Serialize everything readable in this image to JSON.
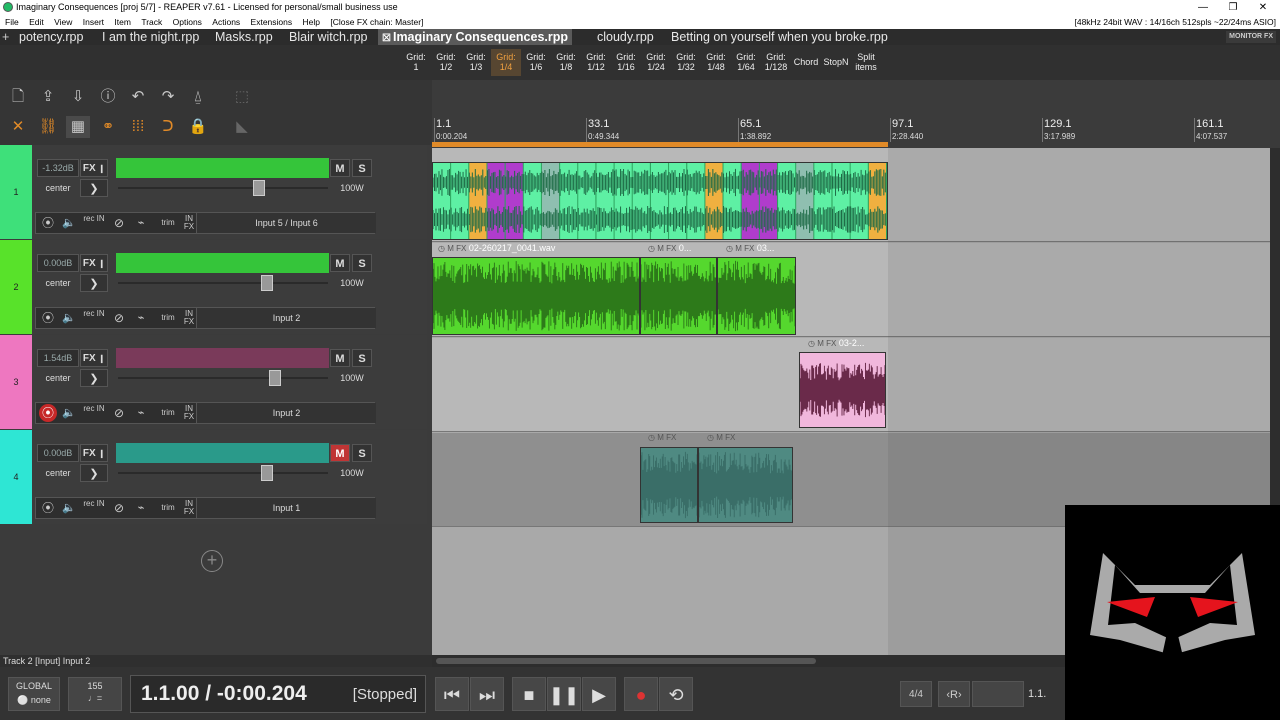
{
  "window": {
    "title": "Imaginary Consequences [proj 5/7] - REAPER v7.61 - Licensed for personal/small business use",
    "minimize": "—",
    "maximize": "❐",
    "close": "✕"
  },
  "menu": {
    "items": [
      "File",
      "Edit",
      "View",
      "Insert",
      "Item",
      "Track",
      "Options",
      "Actions",
      "Extensions",
      "Help",
      "[Close FX chain: Master]"
    ],
    "status": "[48kHz 24bit WAV : 14/16ch 512spls ~22/24ms ASIO]"
  },
  "tabs": {
    "plus": "+",
    "close_glyph": "☒",
    "items": [
      {
        "label": "potency.rpp"
      },
      {
        "label": "I am the night.rpp"
      },
      {
        "label": "Masks.rpp"
      },
      {
        "label": "Blair witch.rpp"
      },
      {
        "label": "Imaginary Consequences.rpp"
      },
      {
        "label": "cloudy.rpp"
      },
      {
        "label": "Betting on yourself when you broke.rpp"
      }
    ],
    "monitor_fx": "MONITOR FX"
  },
  "grid_toolbar": {
    "buttons": [
      {
        "l1": "Grid:",
        "l2": "1"
      },
      {
        "l1": "Grid:",
        "l2": "1/2"
      },
      {
        "l1": "Grid:",
        "l2": "1/3"
      },
      {
        "l1": "Grid:",
        "l2": "1/4"
      },
      {
        "l1": "Grid:",
        "l2": "1/6"
      },
      {
        "l1": "Grid:",
        "l2": "1/8"
      },
      {
        "l1": "Grid:",
        "l2": "1/12"
      },
      {
        "l1": "Grid:",
        "l2": "1/16"
      },
      {
        "l1": "Grid:",
        "l2": "1/24"
      },
      {
        "l1": "Grid:",
        "l2": "1/32"
      },
      {
        "l1": "Grid:",
        "l2": "1/48"
      },
      {
        "l1": "Grid:",
        "l2": "1/64"
      },
      {
        "l1": "Grid:",
        "l2": "1/128"
      },
      {
        "l1": "Chord",
        "l2": ""
      },
      {
        "l1": "StopN",
        "l2": ""
      },
      {
        "l1": "Split",
        "l2": "items"
      }
    ],
    "active_grid": "1/4"
  },
  "tracks": [
    {
      "number": "1",
      "volume": "-1.32dB",
      "pan": "center",
      "width": "100W",
      "input": "Input 5 / Input 6",
      "color": "#3ee07a",
      "name_color": "#35c53a",
      "muted": false,
      "armed": false,
      "fader_pos": 0.69
    },
    {
      "number": "2",
      "volume": "0.00dB",
      "pan": "center",
      "width": "100W",
      "input": "Input 2",
      "color": "#58e22a",
      "name_color": "#35c53a",
      "muted": false,
      "armed": false,
      "fader_pos": 0.73
    },
    {
      "number": "3",
      "volume": "1.54dB",
      "pan": "center",
      "width": "100W",
      "input": "Input 2",
      "color": "#ee77c0",
      "name_color": "#7a3a5a",
      "muted": false,
      "armed": true,
      "fader_pos": 0.77
    },
    {
      "number": "4",
      "volume": "0.00dB",
      "pan": "center",
      "width": "100W",
      "input": "Input 1",
      "color": "#2ee6d4",
      "name_color": "#2a9a8a",
      "muted": true,
      "armed": false,
      "fader_pos": 0.73
    }
  ],
  "track_labels": {
    "fx": "FX",
    "mute": "M",
    "solo": "S",
    "arrow": "❯",
    "rec_in": "rec IN",
    "trim": "trim",
    "in_fx": "IN FX"
  },
  "add_track": "+",
  "status_line": "Track 2 [Input] Input 2",
  "ruler": {
    "marks": [
      {
        "bar": "1.1",
        "time": "0:00.204"
      },
      {
        "bar": "33.1",
        "time": "0:49.344"
      },
      {
        "bar": "65.1",
        "time": "1:38.892"
      },
      {
        "bar": "97.1",
        "time": "2:28.440"
      },
      {
        "bar": "129.1",
        "time": "3:17.989"
      },
      {
        "bar": "161.1",
        "time": "4:07.537"
      }
    ]
  },
  "items": {
    "t2_a": "02-260217_0041.wav",
    "t2_b": "0...",
    "t2_c": "03...",
    "t3": "03-2...",
    "head_buttons": "◷ M FX"
  },
  "transport": {
    "global_label": "GLOBAL",
    "global_value": "none",
    "bpm": "155",
    "bpm_sub": "♩=",
    "time": "1.1.00 / -0:00.204",
    "status": "[Stopped]",
    "time_sig": "4/4",
    "r_button": "‹R›",
    "position": "1.1."
  },
  "colors": {
    "accent": "#e08a28",
    "background": "#3a3a3a",
    "arrange": "#b8b8b8"
  }
}
